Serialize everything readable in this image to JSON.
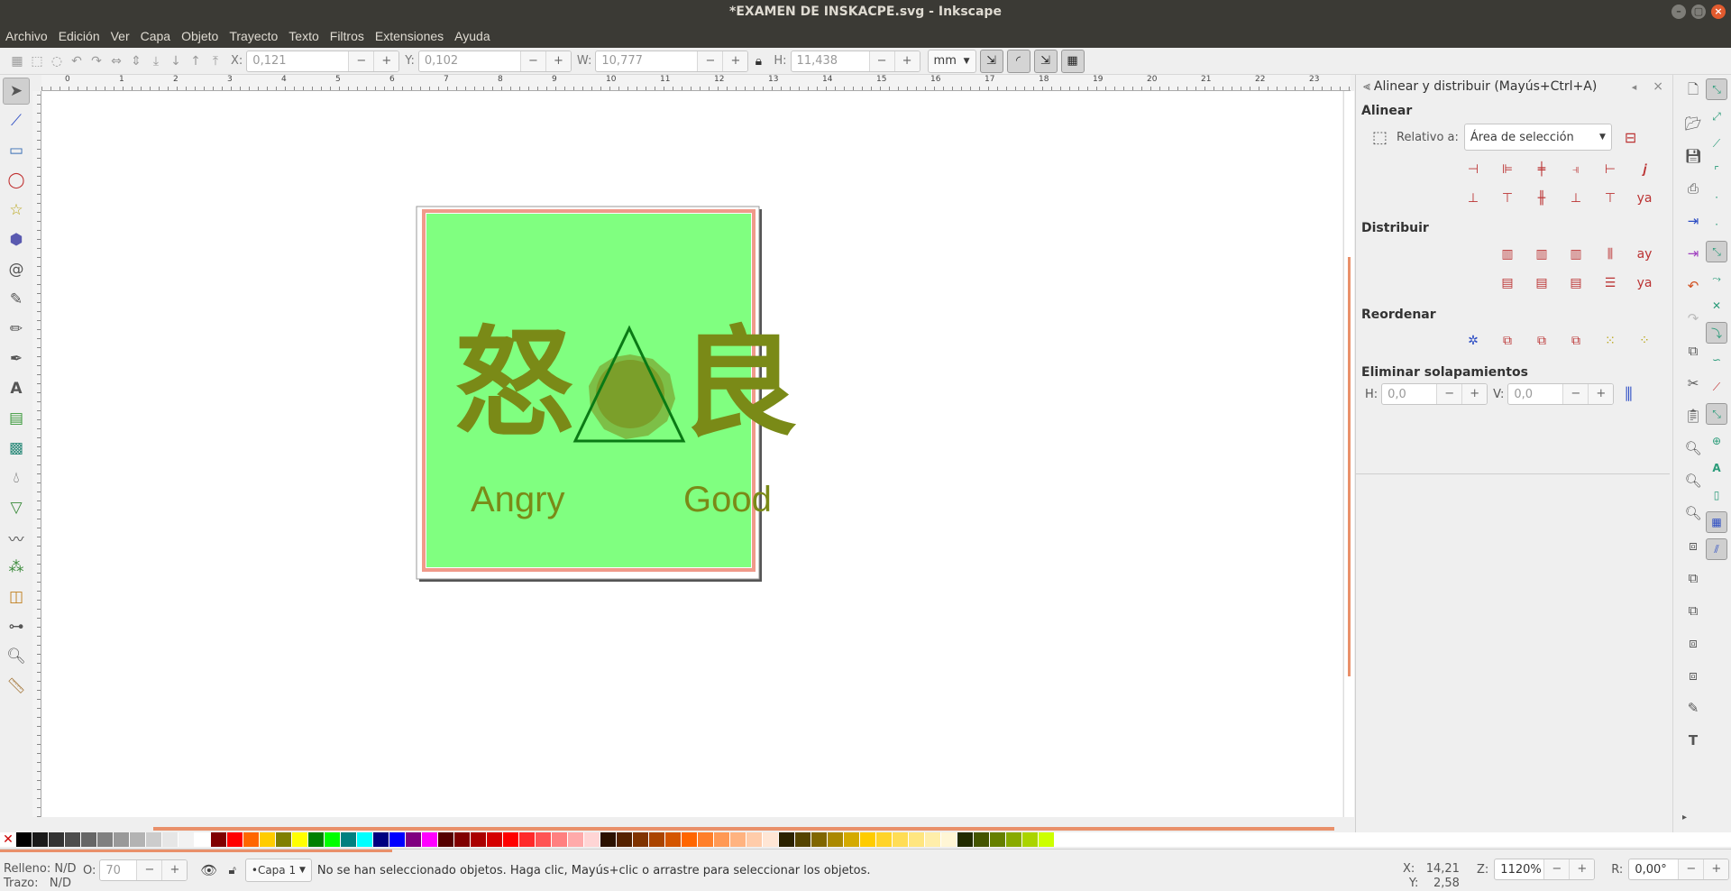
{
  "window": {
    "title": "*EXAMEN DE INSKACPE.svg - Inkscape"
  },
  "menu": [
    "Archivo",
    "Edición",
    "Ver",
    "Capa",
    "Objeto",
    "Trayecto",
    "Texto",
    "Filtros",
    "Extensiones",
    "Ayuda"
  ],
  "controls": {
    "x_label": "X:",
    "x_value": "0,121",
    "y_label": "Y:",
    "y_value": "0,102",
    "w_label": "W:",
    "w_value": "10,777",
    "h_label": "H:",
    "h_value": "11,438",
    "unit": "mm"
  },
  "ruler": {
    "labels": [
      "0",
      "1",
      "2",
      "3",
      "4",
      "5",
      "6",
      "7",
      "8",
      "9",
      "10",
      "11",
      "12",
      "13",
      "14",
      "15",
      "16",
      "17",
      "18",
      "19",
      "20",
      "21",
      "22",
      "23"
    ]
  },
  "artwork": {
    "left_glyph": "怒",
    "right_glyph": "良",
    "left_word": "Angry",
    "right_word": "Good",
    "bg_color": "#80ff80",
    "border_color": "#f09a8a",
    "ink_color": "#7a8a17",
    "triangle_color": "#0a7a15"
  },
  "panel": {
    "title": "Alinear y distribuir (Mayús+Ctrl+A)",
    "align_section": "Alinear",
    "relative_label": "Relativo a:",
    "relative_value": "Área de selección",
    "distribute_section": "Distribuir",
    "reorder_section": "Reordenar",
    "overlap_section": "Eliminar solapamientos",
    "h_label": "H:",
    "h_value": "0,0",
    "v_label": "V:",
    "v_value": "0,0"
  },
  "palette": {
    "colors": [
      "#000000",
      "#1a1a1a",
      "#333333",
      "#4d4d4d",
      "#666666",
      "#808080",
      "#999999",
      "#b3b3b3",
      "#cccccc",
      "#e6e6e6",
      "#f2f2f2",
      "#ffffff",
      "#800000",
      "#ff0000",
      "#ff6600",
      "#ffcc00",
      "#808000",
      "#ffff00",
      "#008000",
      "#00ff00",
      "#008080",
      "#00ffff",
      "#000080",
      "#0000ff",
      "#800080",
      "#ff00ff",
      "#550000",
      "#800000",
      "#aa0000",
      "#d40000",
      "#ff0000",
      "#ff2a2a",
      "#ff5555",
      "#ff8080",
      "#ffaaaa",
      "#ffd5d5",
      "#2b1100",
      "#552200",
      "#803300",
      "#aa4400",
      "#d45500",
      "#ff6600",
      "#ff7f2a",
      "#ff9955",
      "#ffb380",
      "#ffccaa",
      "#ffe6d5",
      "#2b2200",
      "#554400",
      "#806600",
      "#aa8800",
      "#d4aa00",
      "#ffcc00",
      "#ffd42a",
      "#ffdd55",
      "#ffe680",
      "#ffeeaa",
      "#fff6d5",
      "#222b00",
      "#445500",
      "#668000",
      "#88aa00",
      "#aad400",
      "#ccff00"
    ]
  },
  "status": {
    "fill_label": "Relleno:",
    "fill_value": "N/D",
    "stroke_label": "Trazo:",
    "stroke_value": "N/D",
    "opacity_label": "O:",
    "opacity_value": "70",
    "layer": "•Capa 1",
    "message": "No se han seleccionado objetos. Haga clic, Mayús+clic o arrastre para seleccionar los objetos.",
    "x_label": "X:",
    "x_value": "14,21",
    "y_label": "Y:",
    "y_value": "2,58",
    "zoom_label": "Z:",
    "zoom_value": "1120%",
    "rot_label": "R:",
    "rot_value": "0,00°"
  }
}
